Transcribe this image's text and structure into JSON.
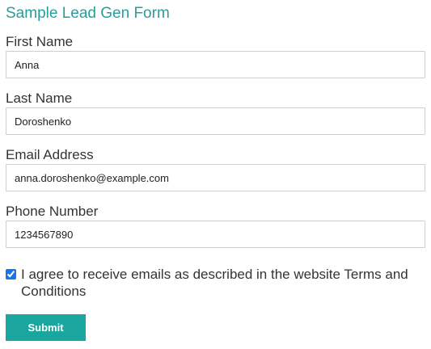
{
  "form": {
    "title": "Sample Lead Gen Form",
    "fields": [
      {
        "label": "First Name",
        "value": "Anna"
      },
      {
        "label": "Last Name",
        "value": "Doroshenko"
      },
      {
        "label": "Email Address",
        "value": "anna.doroshenko@example.com"
      },
      {
        "label": "Phone Number",
        "value": "1234567890"
      }
    ],
    "consent": {
      "checked": true,
      "text": "I agree to receive emails as described in the website Terms and Conditions"
    },
    "submit_label": "Submit"
  },
  "colors": {
    "title": "#2a9d9a",
    "button": "#1aa69f",
    "checkbox": "#1a73e8"
  }
}
